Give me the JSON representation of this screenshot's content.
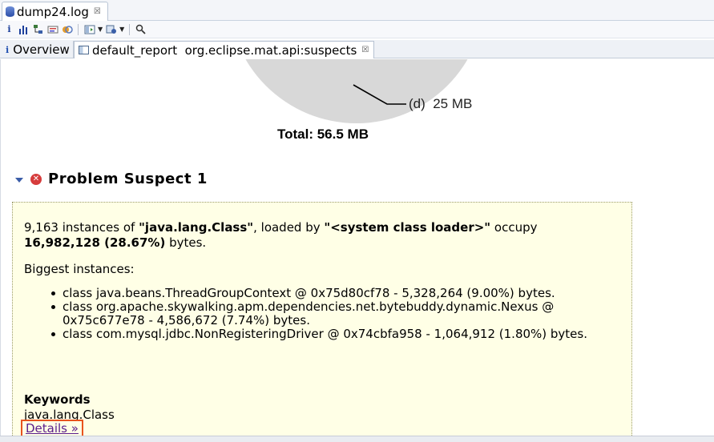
{
  "editor": {
    "tab_title": "dump24.log",
    "tab_close": "☒"
  },
  "toolbar": {
    "buttons": [
      "info-icon",
      "histogram-icon",
      "dominator-tree-icon",
      "oql-icon",
      "thread-overview-icon",
      "run-report-icon",
      "query-browser-icon",
      "find-object-icon"
    ]
  },
  "inner_tabs": {
    "overview_label": "Overview",
    "report_label": "default_report  org.eclipse.mat.api:suspects",
    "report_close": "☒"
  },
  "pie": {
    "slice_label": "(d)  25 MB",
    "total_label": "Total: 56.5 MB"
  },
  "suspect": {
    "title": "Problem Suspect 1",
    "count": "9,163",
    "text_instances_of": "instances of",
    "class_name": "\"java.lang.Class\"",
    "text_loaded_by": ", loaded by",
    "loader": "\"<system class loader>\"",
    "text_occupy": "occupy",
    "bytes_value": "16,982,128 (28.67%)",
    "text_bytes": "bytes.",
    "biggest_heading": "Biggest instances:",
    "instances": [
      "class java.beans.ThreadGroupContext @ 0x75d80cf78 - 5,328,264 (9.00%) bytes.",
      "class org.apache.skywalking.apm.dependencies.net.bytebuddy.dynamic.Nexus @ 0x75c677e78 - 4,586,672 (7.74%) bytes.",
      "class com.mysql.jdbc.NonRegisteringDriver @ 0x74cbfa958 - 1,064,912 (1.80%) bytes."
    ],
    "keywords_heading": "Keywords",
    "keyword": "java.lang.Class",
    "details_link": "Details »"
  }
}
